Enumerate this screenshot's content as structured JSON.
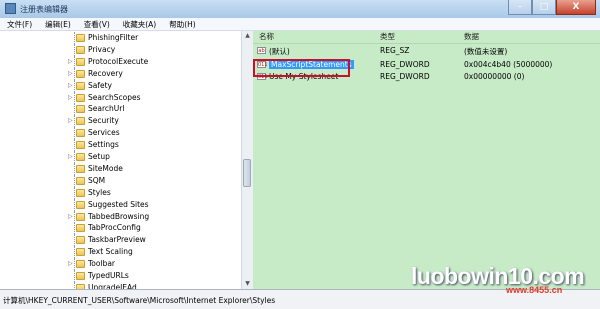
{
  "window": {
    "title": "注册表编辑器",
    "minimize": "–",
    "maximize": "□",
    "close": "X"
  },
  "menu": [
    "文件(F)",
    "编辑(E)",
    "查看(V)",
    "收藏夹(A)",
    "帮助(H)"
  ],
  "tree": {
    "items": [
      {
        "label": "PhishingFilter",
        "expandable": false
      },
      {
        "label": "Privacy",
        "expandable": false
      },
      {
        "label": "ProtocolExecute",
        "expandable": true
      },
      {
        "label": "Recovery",
        "expandable": true
      },
      {
        "label": "Safety",
        "expandable": true
      },
      {
        "label": "SearchScopes",
        "expandable": true
      },
      {
        "label": "SearchUrl",
        "expandable": false
      },
      {
        "label": "Security",
        "expandable": true
      },
      {
        "label": "Services",
        "expandable": false
      },
      {
        "label": "Settings",
        "expandable": false
      },
      {
        "label": "Setup",
        "expandable": true
      },
      {
        "label": "SiteMode",
        "expandable": false
      },
      {
        "label": "SQM",
        "expandable": false
      },
      {
        "label": "Styles",
        "expandable": false
      },
      {
        "label": "Suggested Sites",
        "expandable": false
      },
      {
        "label": "TabbedBrowsing",
        "expandable": true
      },
      {
        "label": "TabProcConfig",
        "expandable": false
      },
      {
        "label": "TaskbarPreview",
        "expandable": false
      },
      {
        "label": "Text Scaling",
        "expandable": false
      },
      {
        "label": "Toolbar",
        "expandable": true
      },
      {
        "label": "TypedURLs",
        "expandable": false
      },
      {
        "label": "UpgradeIEAd",
        "expandable": false
      }
    ]
  },
  "values": {
    "headers": {
      "name": "名称",
      "type": "类型",
      "data": "数据"
    },
    "rows": [
      {
        "name": "(默认)",
        "type": "REG_SZ",
        "data": "(数值未设置)",
        "icon": "ab",
        "selected": false
      },
      {
        "name": "MaxScriptStatements",
        "type": "REG_DWORD",
        "data": "0x004c4b40 (5000000)",
        "icon": "011",
        "selected": true
      },
      {
        "name": "Use My Stylesheet",
        "type": "REG_DWORD",
        "data": "0x00000000 (0)",
        "icon": "011",
        "selected": false
      }
    ]
  },
  "status": {
    "path": "计算机\\HKEY_CURRENT_USER\\Software\\Microsoft\\Internet Explorer\\Styles"
  },
  "watermark": {
    "main": "luobowin10.com",
    "sub": "www.8455.cn"
  },
  "colors": {
    "right_pane_bg": "#c7ebc7",
    "selection": "#3399ff",
    "highlight_border": "#c8102e"
  }
}
